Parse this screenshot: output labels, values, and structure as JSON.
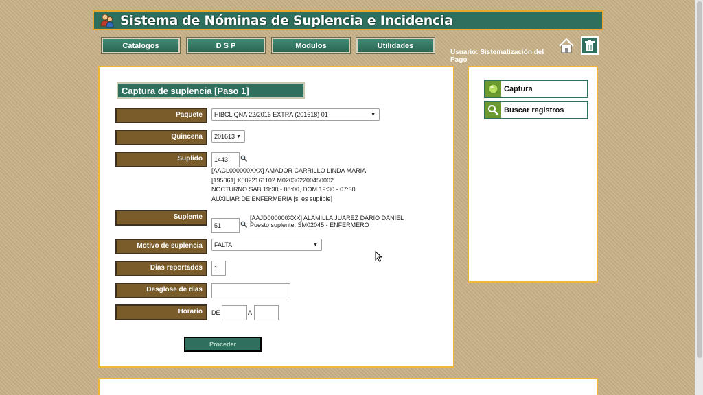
{
  "header": {
    "title": "Sistema de Nóminas de Suplencia e Incidencia",
    "logo_icon": "users-icon"
  },
  "nav": {
    "items": [
      "Catalogos",
      "D S P",
      "Modulos",
      "Utilidades"
    ],
    "user_label": "Usuario: Sistematización del Pago",
    "home_icon": "home-icon",
    "trash_icon": "trash-icon"
  },
  "form": {
    "title": "Captura de suplencia [Paso 1]",
    "paquete": {
      "label": "Paquete",
      "value": "HIBCL QNA 22/2016 EXTRA (201618) 01"
    },
    "quincena": {
      "label": "Quincena",
      "value": "201613"
    },
    "suplido": {
      "label": "Suplido",
      "value": "1443",
      "details": [
        "[AACL000000XXX] AMADOR CARRILLO LINDA MARIA",
        "[195061] X0022161102 M020362200450002",
        "NOCTURNO SAB 19:30 - 08:00, DOM 19:30 - 07:30",
        "AUXILIAR DE ENFERMERIA [si es suplible]"
      ]
    },
    "suplente": {
      "label": "Suplente",
      "value": "51",
      "details": [
        "[AAJD000000XXX] ALAMILLA JUAREZ DARIO DANIEL",
        "Puesto suplente: SM02045 - ENFERMERO"
      ]
    },
    "motivo": {
      "label": "Motivo de suplencia",
      "value": "FALTA"
    },
    "dias": {
      "label": "Dias reportados",
      "value": "1"
    },
    "desglose": {
      "label": "Desglose de dias",
      "value": ""
    },
    "horario": {
      "label": "Horario",
      "de_label": "DE",
      "a_label": "A",
      "de_value": "",
      "a_value": ""
    },
    "submit_label": "Proceder"
  },
  "sidebar": {
    "items": [
      {
        "label": "Captura",
        "icon": "circle-icon"
      },
      {
        "label": "Buscar registros",
        "icon": "search-icon"
      }
    ]
  }
}
